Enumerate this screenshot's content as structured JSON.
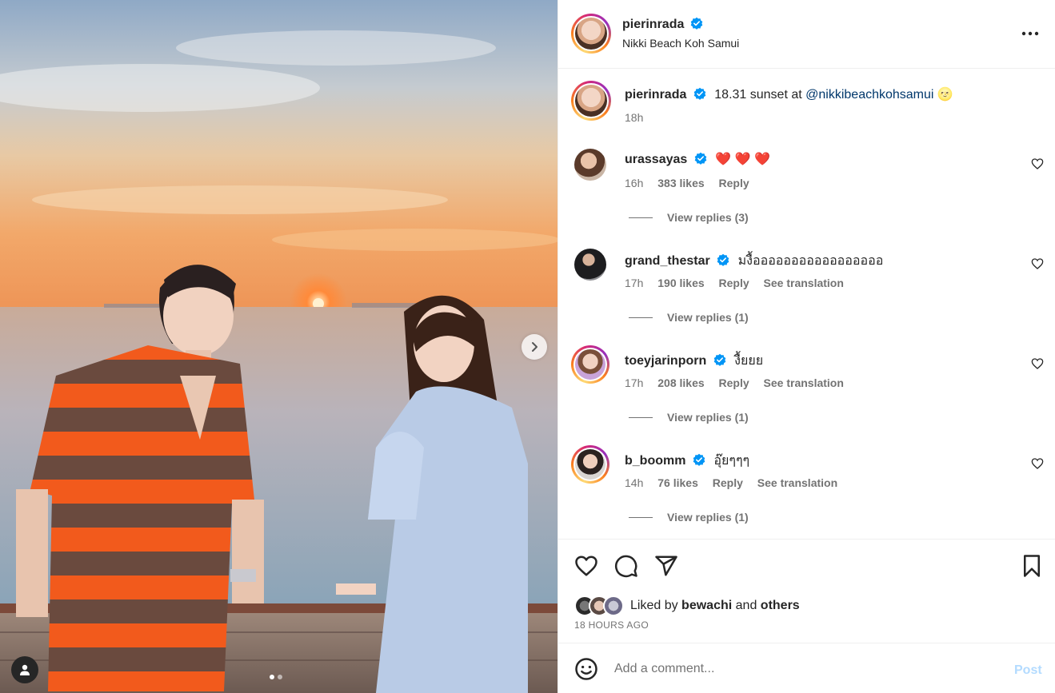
{
  "post": {
    "author": "pierinrada",
    "location": "Nikki Beach Koh Samui",
    "caption_text": "18.31 sunset at",
    "caption_mention": "@nikkibeachkohsamui",
    "caption_emoji": "🌝",
    "caption_time": "18h"
  },
  "comments": [
    {
      "user": "urassayas",
      "text": "❤️ ❤️ ❤️",
      "time": "16h",
      "likes": "383 likes",
      "reply": "Reply",
      "translate": "",
      "view_replies": "View replies (3)"
    },
    {
      "user": "grand_thestar",
      "text": "มงื้อออออออออออออออออ",
      "time": "17h",
      "likes": "190 likes",
      "reply": "Reply",
      "translate": "See translation",
      "view_replies": "View replies (1)"
    },
    {
      "user": "toeyjarinporn",
      "text": "งื้ยยย",
      "time": "17h",
      "likes": "208 likes",
      "reply": "Reply",
      "translate": "See translation",
      "view_replies": "View replies (1)"
    },
    {
      "user": "b_boomm",
      "text": "อุ๊ยๆๆๆ",
      "time": "14h",
      "likes": "76 likes",
      "reply": "Reply",
      "translate": "See translation",
      "view_replies": "View replies (1)"
    }
  ],
  "engagement": {
    "liked_prefix": "Liked by",
    "liked_user": "bewachi",
    "liked_and": "and",
    "liked_others": "others",
    "time_ago": "18 HOURS AGO"
  },
  "composer": {
    "placeholder": "Add a comment...",
    "post_label": "Post"
  },
  "carousel": {
    "current_slide": 1,
    "total_slides": 2
  },
  "colors": {
    "verified": "#0095f6",
    "link": "#00376b",
    "post_disabled": "#b3dbff",
    "muted": "#737373"
  },
  "icons": [
    "verified-badge-icon",
    "more-options-icon",
    "heart-icon",
    "comment-icon",
    "share-icon",
    "bookmark-icon",
    "emoji-icon",
    "chevron-right-icon",
    "user-tag-icon"
  ]
}
